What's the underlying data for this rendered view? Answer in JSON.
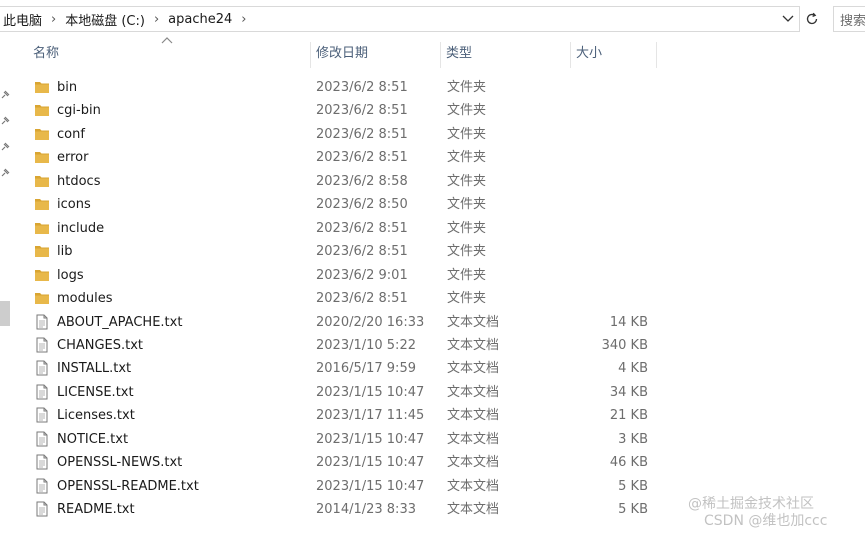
{
  "address_bar": {
    "crumbs": [
      "此电脑",
      "本地磁盘 (C:)",
      "apache24"
    ],
    "search_placeholder": "搜索"
  },
  "columns": {
    "name": "名称",
    "date": "修改日期",
    "type": "类型",
    "size": "大小"
  },
  "files": [
    {
      "name": "bin",
      "date": "2023/6/2 8:51",
      "type": "文件夹",
      "size": "",
      "kind": "folder-icon"
    },
    {
      "name": "cgi-bin",
      "date": "2023/6/2 8:51",
      "type": "文件夹",
      "size": "",
      "kind": "folder-icon"
    },
    {
      "name": "conf",
      "date": "2023/6/2 8:51",
      "type": "文件夹",
      "size": "",
      "kind": "folder-icon"
    },
    {
      "name": "error",
      "date": "2023/6/2 8:51",
      "type": "文件夹",
      "size": "",
      "kind": "folder-icon"
    },
    {
      "name": "htdocs",
      "date": "2023/6/2 8:58",
      "type": "文件夹",
      "size": "",
      "kind": "folder-icon"
    },
    {
      "name": "icons",
      "date": "2023/6/2 8:50",
      "type": "文件夹",
      "size": "",
      "kind": "folder-icon"
    },
    {
      "name": "include",
      "date": "2023/6/2 8:51",
      "type": "文件夹",
      "size": "",
      "kind": "folder-icon"
    },
    {
      "name": "lib",
      "date": "2023/6/2 8:51",
      "type": "文件夹",
      "size": "",
      "kind": "folder-icon"
    },
    {
      "name": "logs",
      "date": "2023/6/2 9:01",
      "type": "文件夹",
      "size": "",
      "kind": "folder-icon"
    },
    {
      "name": "modules",
      "date": "2023/6/2 8:51",
      "type": "文件夹",
      "size": "",
      "kind": "folder-icon"
    },
    {
      "name": "ABOUT_APACHE.txt",
      "date": "2020/2/20 16:33",
      "type": "文本文档",
      "size": "14 KB",
      "kind": "text-file-icon"
    },
    {
      "name": "CHANGES.txt",
      "date": "2023/1/10 5:22",
      "type": "文本文档",
      "size": "340 KB",
      "kind": "text-file-icon"
    },
    {
      "name": "INSTALL.txt",
      "date": "2016/5/17 9:59",
      "type": "文本文档",
      "size": "4 KB",
      "kind": "text-file-icon"
    },
    {
      "name": "LICENSE.txt",
      "date": "2023/1/15 10:47",
      "type": "文本文档",
      "size": "34 KB",
      "kind": "text-file-icon"
    },
    {
      "name": "Licenses.txt",
      "date": "2023/1/17 11:45",
      "type": "文本文档",
      "size": "21 KB",
      "kind": "text-file-icon"
    },
    {
      "name": "NOTICE.txt",
      "date": "2023/1/15 10:47",
      "type": "文本文档",
      "size": "3 KB",
      "kind": "text-file-icon"
    },
    {
      "name": "OPENSSL-NEWS.txt",
      "date": "2023/1/15 10:47",
      "type": "文本文档",
      "size": "46 KB",
      "kind": "text-file-icon"
    },
    {
      "name": "OPENSSL-README.txt",
      "date": "2023/1/15 10:47",
      "type": "文本文档",
      "size": "5 KB",
      "kind": "text-file-icon"
    },
    {
      "name": "README.txt",
      "date": "2014/1/23 8:33",
      "type": "文本文档",
      "size": "5 KB",
      "kind": "text-file-icon"
    }
  ],
  "watermark": {
    "line1": "@稀土掘金技术社区",
    "line2": "CSDN @维也加ccc"
  },
  "colors": {
    "folder": "#e8b84a",
    "folder_dark": "#d9a532",
    "header_text": "#4c607a",
    "secondary_text": "#6d6d6d"
  }
}
